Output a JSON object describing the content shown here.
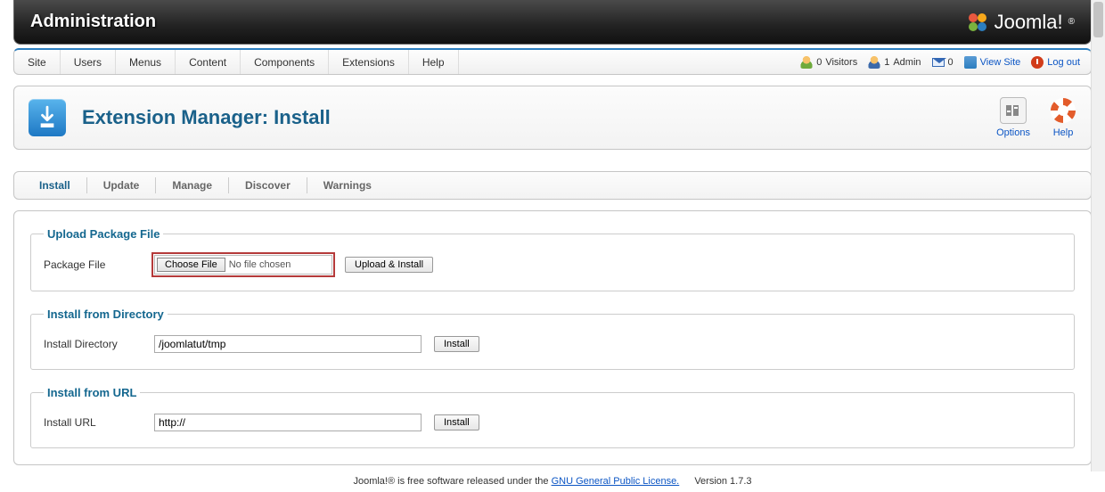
{
  "banner": {
    "title": "Administration",
    "brand": "Joomla!"
  },
  "menu": {
    "items": [
      "Site",
      "Users",
      "Menus",
      "Content",
      "Components",
      "Extensions",
      "Help"
    ]
  },
  "status": {
    "visitors": {
      "count": "0",
      "label": "Visitors"
    },
    "admins": {
      "count": "1",
      "label": "Admin"
    },
    "messages": {
      "count": "0"
    },
    "view_site": "View Site",
    "logout": "Log out"
  },
  "page": {
    "title": "Extension Manager: Install",
    "toolbar": {
      "options": "Options",
      "help": "Help"
    }
  },
  "tabs": {
    "items": [
      "Install",
      "Update",
      "Manage",
      "Discover",
      "Warnings"
    ],
    "active_index": 0
  },
  "sections": {
    "upload": {
      "legend": "Upload Package File",
      "label": "Package File",
      "choose_btn": "Choose File",
      "file_status": "No file chosen",
      "submit": "Upload & Install"
    },
    "directory": {
      "legend": "Install from Directory",
      "label": "Install Directory",
      "value": "/joomlatut/tmp",
      "submit": "Install"
    },
    "url": {
      "legend": "Install from URL",
      "label": "Install URL",
      "value": "http://",
      "submit": "Install"
    }
  },
  "footer": {
    "prefix": "Joomla!® is free software released under the ",
    "license_link": "GNU General Public License.",
    "version": "Version 1.7.3"
  }
}
